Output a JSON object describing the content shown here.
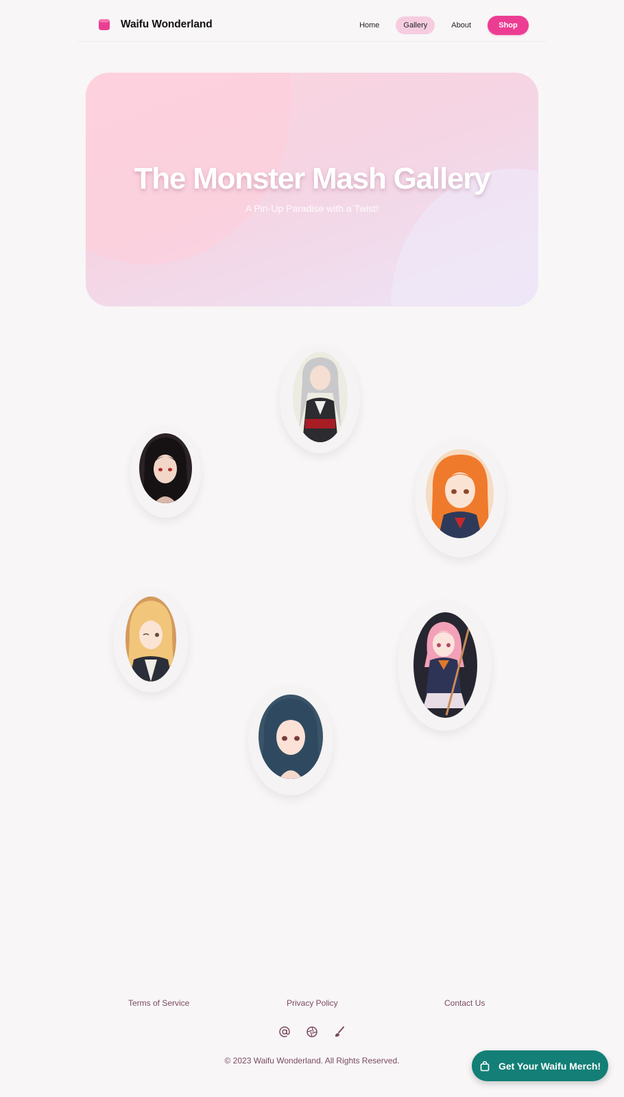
{
  "header": {
    "brand": "Waifu Wonderland",
    "nav": [
      {
        "label": "Home"
      },
      {
        "label": "Gallery"
      },
      {
        "label": "About"
      }
    ],
    "shop_label": "Shop"
  },
  "hero": {
    "title": "The Monster Mash Gallery",
    "subtitle": "A Pin-Up Paradise with a Twist!"
  },
  "footer": {
    "links": [
      "Terms of Service",
      "Privacy Policy",
      "Contact Us"
    ],
    "social_icons": [
      "at-sign-icon",
      "aperture-icon",
      "paintbrush-icon"
    ],
    "copyright": "© 2023 Waifu Wonderland. All Rights Reserved."
  },
  "merch_button": {
    "label": "Get Your Waifu Merch!",
    "icon": "shopping-bag-icon"
  },
  "colors": {
    "accent": "#ec3d93",
    "teal": "#137f76",
    "footer_text": "#7a4a60"
  }
}
